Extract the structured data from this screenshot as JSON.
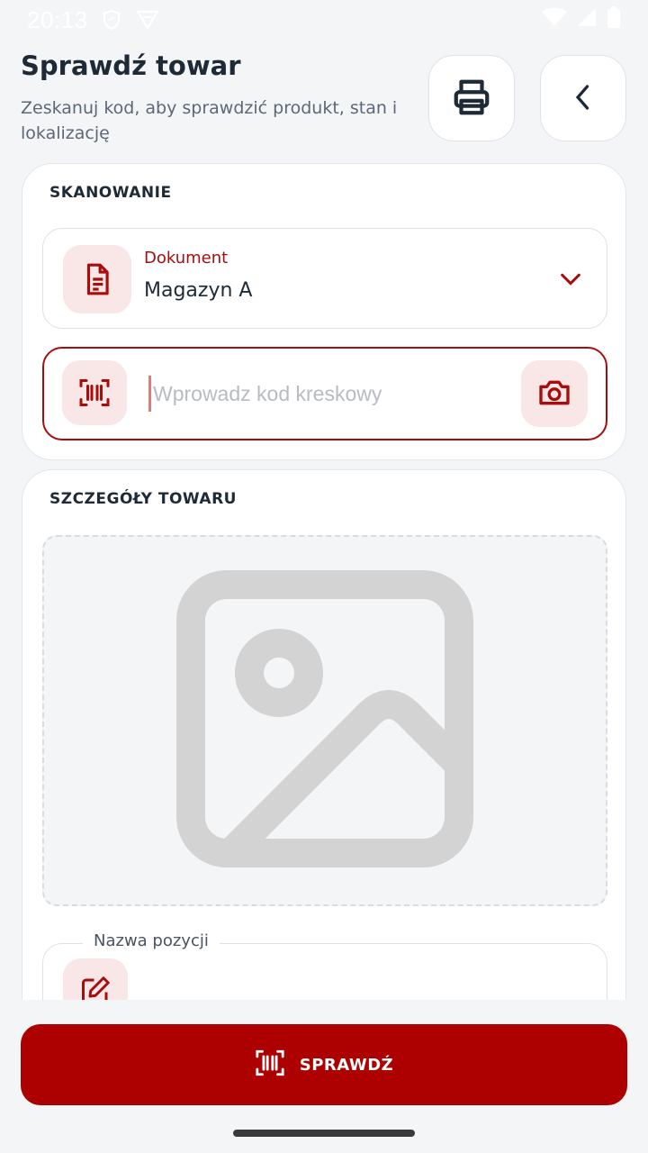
{
  "status_bar": {
    "time": "20:13",
    "icons": [
      "shield-icon",
      "vpn-icon",
      "wifi-icon",
      "signal-icon",
      "battery-icon"
    ]
  },
  "header": {
    "title": "Sprawdź towar",
    "subtitle": "Zeskanuj kod, aby sprawdzić produkt, stan i lokalizację",
    "print_icon": "printer-icon",
    "back_icon": "chevron-left-icon"
  },
  "scan_section": {
    "title": "SKANOWANIE",
    "document": {
      "label": "Dokument",
      "value": "Magazyn A",
      "icon": "document-icon"
    },
    "barcode": {
      "placeholder": "Wprowadz kod kreskowy",
      "value": "",
      "icon": "barcode-scan-icon",
      "camera_icon": "camera-icon"
    }
  },
  "details_section": {
    "title": "SZCZEGÓŁY TOWARU",
    "image_icon": "image-placeholder-icon",
    "name_field": {
      "label": "Nazwa pozycji",
      "icon": "edit-icon"
    }
  },
  "actions": {
    "check_label": "SPRAWDŹ"
  },
  "colors": {
    "accent": "#ad0000",
    "accent_light": "#f9e6e7",
    "background": "#f4f5f7"
  }
}
